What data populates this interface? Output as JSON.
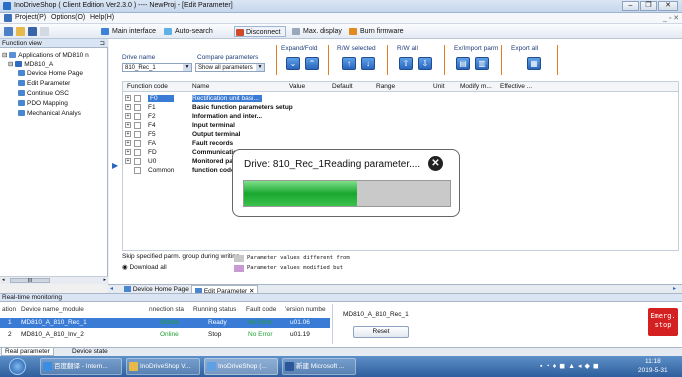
{
  "window": {
    "title": "InoDriveShop ( Client Edition Ver2.3.0 )  ----  NewProj - [Edit Parameter]",
    "controls": [
      "–",
      "❐",
      "✕"
    ]
  },
  "menu": {
    "project": "Project(P)",
    "options": "Options(O)",
    "help": "Help(H)",
    "right": "_ ▫ ✕"
  },
  "toolbar": {
    "main_interface": "Main interface",
    "auto_search": "Auto-search",
    "disconnect": "Disconnect",
    "max_display": "Max. display",
    "burn_firmware": "Burn firmware"
  },
  "left_panel": {
    "header": "Function view",
    "pin": "⊐",
    "tree": {
      "root": "Applications of MD810 n",
      "device": "MD810_A",
      "items": [
        "Device Home Page",
        "Edit Parameter",
        "Continue OSC",
        "PDO Mapping",
        "Mechanical Analys"
      ]
    },
    "scroll_value": "III"
  },
  "params": {
    "drive_name_label": "Drive name",
    "drive_name_value": "810_Rec_1",
    "compare_label": "Compare parameters",
    "compare_value": "Show all parameters",
    "expand_fold": "Expand/Fold",
    "rw_selected": "R/W selected",
    "rw_all": "R/W all",
    "ex_import": "Ex/Import parm",
    "export_all": "Export all"
  },
  "table": {
    "headers": [
      "Function code",
      "Name",
      "Value",
      "Default",
      "Range",
      "Unit",
      "Modify m...",
      "Effective ..."
    ],
    "rows": [
      {
        "code": "F0",
        "name": "Rectification unit basi..."
      },
      {
        "code": "F1",
        "name": "Basic function parameters setup"
      },
      {
        "code": "F2",
        "name": "Information and inter..."
      },
      {
        "code": "F4",
        "name": "Input terminal"
      },
      {
        "code": "F5",
        "name": "Output terminal"
      },
      {
        "code": "FA",
        "name": "Fault records"
      },
      {
        "code": "FD",
        "name": "Communication"
      },
      {
        "code": "U0",
        "name": "Monitored para"
      },
      {
        "code": "Common",
        "name": "function codes"
      }
    ]
  },
  "dialog": {
    "message": "Drive: 810_Rec_1Reading parameter....",
    "progress": 0.55
  },
  "skip": {
    "label": "Skip specified parm. group during writing",
    "download_all": "Download all",
    "legend_diff": "Parameter values different from",
    "legend_mod": "Parameter values modified but"
  },
  "tabs": {
    "home": "Device Home Page",
    "edit": "Edit Parameter",
    "close": "✕"
  },
  "rtm": {
    "header": "Real-time monitoring",
    "columns": [
      "ation",
      "Device name_module",
      "nnection sta",
      "Running status",
      "Fault code",
      "'ersion numbe"
    ],
    "rows": [
      {
        "no": "1",
        "name": "MD810_A_810_Rec_1",
        "conn": "Online",
        "run": "Ready",
        "fault": "No Error",
        "ver": "u01.06"
      },
      {
        "no": "2",
        "name": "MD810_A_810_Inv_2",
        "conn": "Online",
        "run": "Stop",
        "fault": "No Error",
        "ver": "u01.19"
      }
    ],
    "device_label": "MD810_A_810_Rec_1",
    "reset": "Reset",
    "estop": "Emerg.\nstop"
  },
  "status_tabs": {
    "real_parameter": "Real parameter",
    "device_state": "Device state"
  },
  "taskbar": {
    "tasks": [
      "百度翻译 - Intern...",
      "InoDriveShop V...",
      "InoDriveShop (...",
      "新建 Microsoft ..."
    ],
    "time": "11:18",
    "date": "2019-5-31"
  },
  "colors": {
    "accent": "#3a7bd5",
    "progress": "#19a730",
    "estop": "#d42020"
  }
}
